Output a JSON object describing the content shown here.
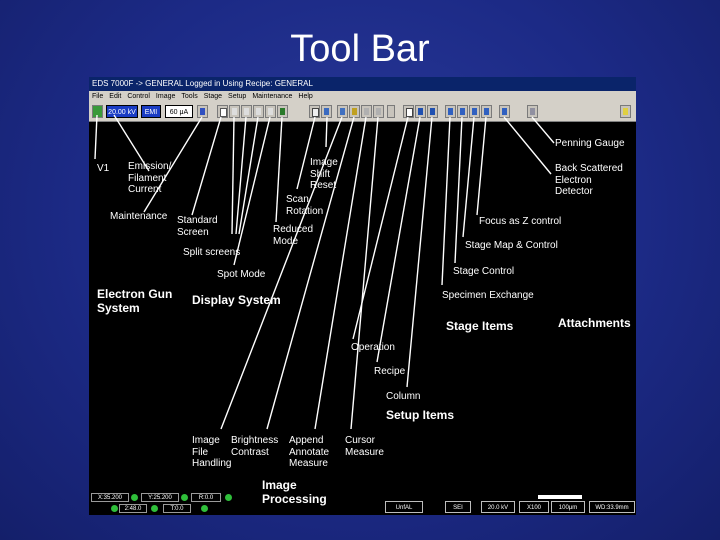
{
  "slide": {
    "title": "Tool Bar"
  },
  "window": {
    "title": "EDS 7000F -> GENERAL Logged in Using Recipe: GENERAL",
    "menu": [
      "File",
      "Edit",
      "Control",
      "Image",
      "Tools",
      "Stage",
      "Setup",
      "Maintenance",
      "Help"
    ]
  },
  "toolbar": {
    "voltage_field": "20.00 kV",
    "mode_field": "EMI",
    "current_field": "60 μA"
  },
  "callouts": {
    "v1": "V1",
    "emission": "Emission/\nFilament\nCurrent",
    "maintenance": "Maintenance",
    "standard_screen": "Standard\nScreen",
    "split_screens": "Split screens",
    "spot_mode": "Spot Mode",
    "image_shift_reset": "Image\nShift\nReset",
    "scan_rotation": "Scan\nRotation",
    "reduced_mode": "Reduced\nMode",
    "penning_gauge": "Penning Gauge",
    "back_scattered": "Back Scattered\nElectron\nDetector",
    "focus_z": "Focus as Z control",
    "stage_map": "Stage Map & Control",
    "stage_control": "Stage Control",
    "specimen_exchange": "Specimen Exchange",
    "operation": "Operation",
    "recipe": "Recipe",
    "column": "Column",
    "image_file": "Image\nFile\nHandling",
    "brightness_contrast": "Brightness\nContrast",
    "append_annotate": "Append\nAnnotate\nMeasure",
    "cursor_measure": "Cursor\nMeasure"
  },
  "groups": {
    "electron_gun": "Electron Gun\nSystem",
    "display_system": "Display System",
    "stage_items": "Stage Items",
    "attachments": "Attachments",
    "setup_items": "Setup Items",
    "image_processing": "Image\nProcessing"
  },
  "status": {
    "x": "X:35.200",
    "y": "Y:25.200",
    "r": "R:0.0",
    "t": "2:48.0",
    "t2": "T:0.0"
  },
  "infobar": {
    "user": "UnfAL",
    "detector": "SEI",
    "kv": "20.0 kV",
    "mag": "X100",
    "scale": "100μm",
    "wd": "WD:33.9mm"
  },
  "colors": {
    "background": "#1c2a86",
    "screen": "#000000",
    "field": "#1a3cc4",
    "status_dot": "#2fbf3a"
  }
}
